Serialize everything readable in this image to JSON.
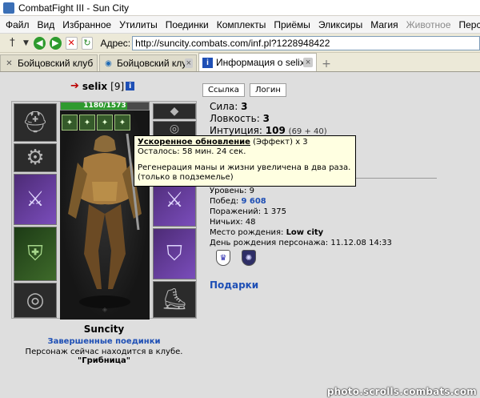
{
  "window": {
    "title": "CombatFight III - Sun City"
  },
  "menubar": {
    "items": [
      "Файл",
      "Вид",
      "Избранное",
      "Утилиты",
      "Поединки",
      "Комплекты",
      "Приёмы",
      "Эликсиры",
      "Магия",
      "Животное",
      "Персонаж"
    ]
  },
  "navbar": {
    "address_label": "Адрес:",
    "url": "http://suncity.combats.com/inf.pl?1228948422"
  },
  "tabs": [
    {
      "label": "Бойцовский клуб",
      "icon": "close-x-icon"
    },
    {
      "label": "Бойцовский клуб.",
      "icon": "globe-icon"
    },
    {
      "label": "Информация о selix",
      "icon": "info-icon"
    }
  ],
  "character": {
    "name": "selix",
    "level": "[9]",
    "hp_text": "1180/1573",
    "hp_ratio": 0.75,
    "buttons": [
      "Ссылка",
      "Логин"
    ],
    "stats": [
      {
        "label": "Сила:",
        "value": "3",
        "bonus": ""
      },
      {
        "label": "Ловкость:",
        "value": "3",
        "bonus": ""
      },
      {
        "label": "Интуиция:",
        "value": "109",
        "bonus": "(69 + 40)"
      }
    ],
    "info": [
      {
        "label": "Уровень:",
        "value": "9"
      },
      {
        "label": "Побед:",
        "value": "9 608"
      },
      {
        "label": "Поражений:",
        "value": "1 375"
      },
      {
        "label": "Ничьих:",
        "value": "48"
      },
      {
        "label": "Место рождения:",
        "value": "Low city"
      },
      {
        "label": "День рождения персонажа:",
        "value": "11.12.08 14:33"
      }
    ],
    "gifts_label": "Подарки"
  },
  "tooltip": {
    "title": "Ускоренное обновление",
    "title_suffix": " (Эффект) х 3",
    "remaining": "Осталось: 58 мин. 24 сек.",
    "desc": "Регенерация маны и жизни увеличена в два раза.",
    "note": "(только в подземелье)"
  },
  "location": {
    "city": "Suncity",
    "finished_link": "Завершенные поединки",
    "text": "Персонаж сейчас находится в клубе.",
    "club": "\"Грибница\""
  },
  "watermark": "photo.scrolls.combats.com"
}
